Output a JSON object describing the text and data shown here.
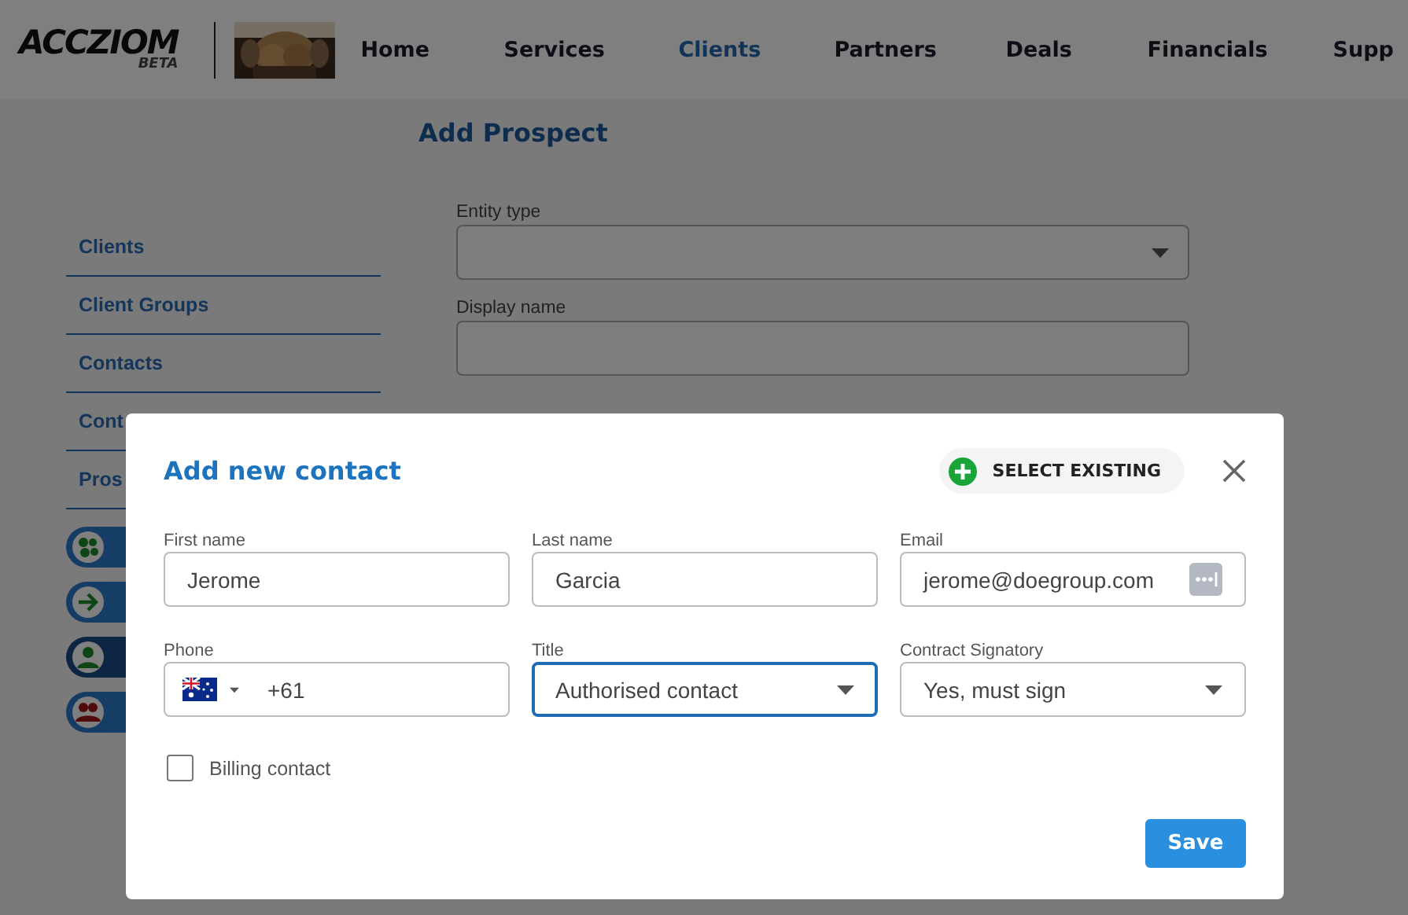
{
  "header": {
    "logo": "ACCZIOM",
    "logo_badge": "BETA",
    "nav": [
      {
        "label": "Home",
        "selected": false
      },
      {
        "label": "Services",
        "selected": false
      },
      {
        "label": "Clients",
        "selected": true
      },
      {
        "label": "Partners",
        "selected": false
      },
      {
        "label": "Deals",
        "selected": false
      },
      {
        "label": "Financials",
        "selected": false
      },
      {
        "label": "Supp",
        "selected": false
      }
    ]
  },
  "sidebar": {
    "items": [
      {
        "label": "Clients"
      },
      {
        "label": "Client Groups"
      },
      {
        "label": "Contacts"
      },
      {
        "label": "Cont"
      },
      {
        "label": "Pros"
      }
    ],
    "pills": [
      {
        "kind": "groups",
        "selected": false
      },
      {
        "kind": "arrow",
        "selected": false
      },
      {
        "kind": "person",
        "selected": true
      },
      {
        "kind": "people",
        "selected": false
      }
    ]
  },
  "page": {
    "title": "Add Prospect",
    "fields": [
      {
        "label": "Entity type",
        "kind": "select"
      },
      {
        "label": "Display name",
        "kind": "text"
      }
    ]
  },
  "modal": {
    "title": "Add new contact",
    "select_existing": "SELECT EXISTING",
    "fields": [
      {
        "label": "First name",
        "kind": "text",
        "value": "Jerome",
        "focused": false
      },
      {
        "label": "Last name",
        "kind": "text",
        "value": "Garcia",
        "focused": false
      },
      {
        "label": "Email",
        "kind": "email",
        "value": "jerome@doegroup.com",
        "focused": false
      },
      {
        "label": "Phone",
        "kind": "phone",
        "value": "+61",
        "focused": false
      },
      {
        "label": "Title",
        "kind": "select",
        "value": "Authorised contact",
        "focused": true
      },
      {
        "label": "Contract Signatory",
        "kind": "select",
        "value": "Yes, must sign",
        "focused": false
      }
    ],
    "billing_contact": {
      "label": "Billing contact",
      "checked": false
    },
    "save": "Save"
  }
}
